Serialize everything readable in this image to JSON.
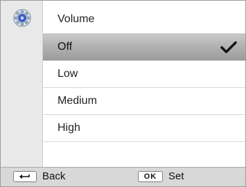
{
  "header": {
    "title": "Volume",
    "icon": "settings-icon"
  },
  "menu": {
    "items": [
      {
        "label": "Off",
        "selected": true
      },
      {
        "label": "Low",
        "selected": false
      },
      {
        "label": "Medium",
        "selected": false
      },
      {
        "label": "High",
        "selected": false
      }
    ],
    "check_icon": "check-icon"
  },
  "footer": {
    "back_label": "Back",
    "back_key_icon": "back-arrow-icon",
    "ok_key_label": "OK",
    "set_label": "Set"
  },
  "colors": {
    "selected_row": "#b0b0b0",
    "icon_column": "#e9e9e9",
    "bottom_bar": "#d8d8d8"
  }
}
